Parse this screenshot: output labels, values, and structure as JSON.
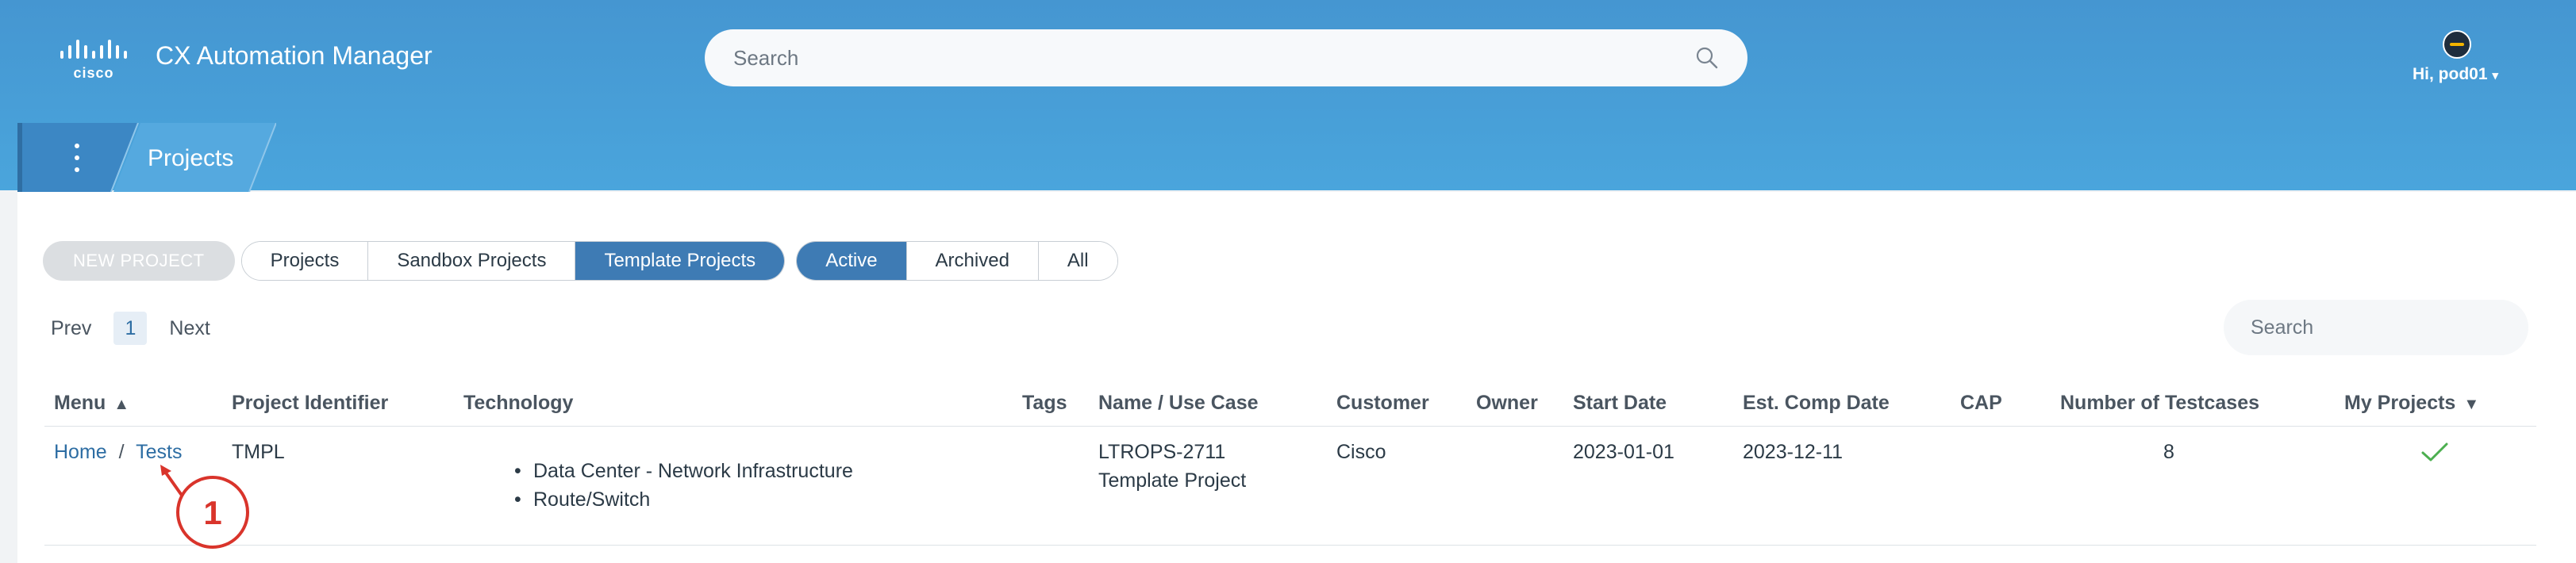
{
  "header": {
    "brand": "cisco",
    "app_title": "CX Automation Manager",
    "search_placeholder": "Search",
    "user_label": "Hi, pod01",
    "user_caret": "▾"
  },
  "subnav": {
    "crumb": "Projects"
  },
  "toolbar": {
    "new_project": "NEW PROJECT",
    "type_filter": [
      {
        "label": "Projects",
        "selected": false
      },
      {
        "label": "Sandbox Projects",
        "selected": false
      },
      {
        "label": "Template Projects",
        "selected": true
      }
    ],
    "status_filter": [
      {
        "label": "Active",
        "selected": true
      },
      {
        "label": "Archived",
        "selected": false
      },
      {
        "label": "All",
        "selected": false
      }
    ]
  },
  "pager": {
    "prev": "Prev",
    "page": "1",
    "next": "Next"
  },
  "table_search": {
    "placeholder": "Search"
  },
  "table": {
    "columns": {
      "menu": "Menu",
      "menu_sort": "▲",
      "project_identifier": "Project Identifier",
      "technology": "Technology",
      "tags": "Tags",
      "name_use_case": "Name / Use Case",
      "customer": "Customer",
      "owner": "Owner",
      "start_date": "Start Date",
      "est_comp_date": "Est. Comp Date",
      "cap": "CAP",
      "number_of_testcases": "Number of Testcases",
      "my_projects": "My Projects",
      "my_projects_sort": "▼"
    },
    "rows": [
      {
        "menu_home": "Home",
        "menu_sep": "/",
        "menu_tests": "Tests",
        "project_identifier": "TMPL",
        "technology": [
          "Data Center - Network Infrastructure",
          "Route/Switch"
        ],
        "tags": "",
        "name_line1": "LTROPS-2711",
        "name_line2": "Template Project",
        "customer": "Cisco",
        "owner": "",
        "start_date": "2023-01-01",
        "est_comp_date": "2023-12-11",
        "cap": "",
        "number_of_testcases": "8",
        "my_project_icon": "check-icon"
      }
    ]
  },
  "annotation": {
    "number": "1"
  },
  "colors": {
    "header_blue": "#4596d1",
    "selected_segment": "#3e7bb4",
    "link": "#2d6da3",
    "check": "#4caf50",
    "annotation_red": "#d9342b"
  }
}
